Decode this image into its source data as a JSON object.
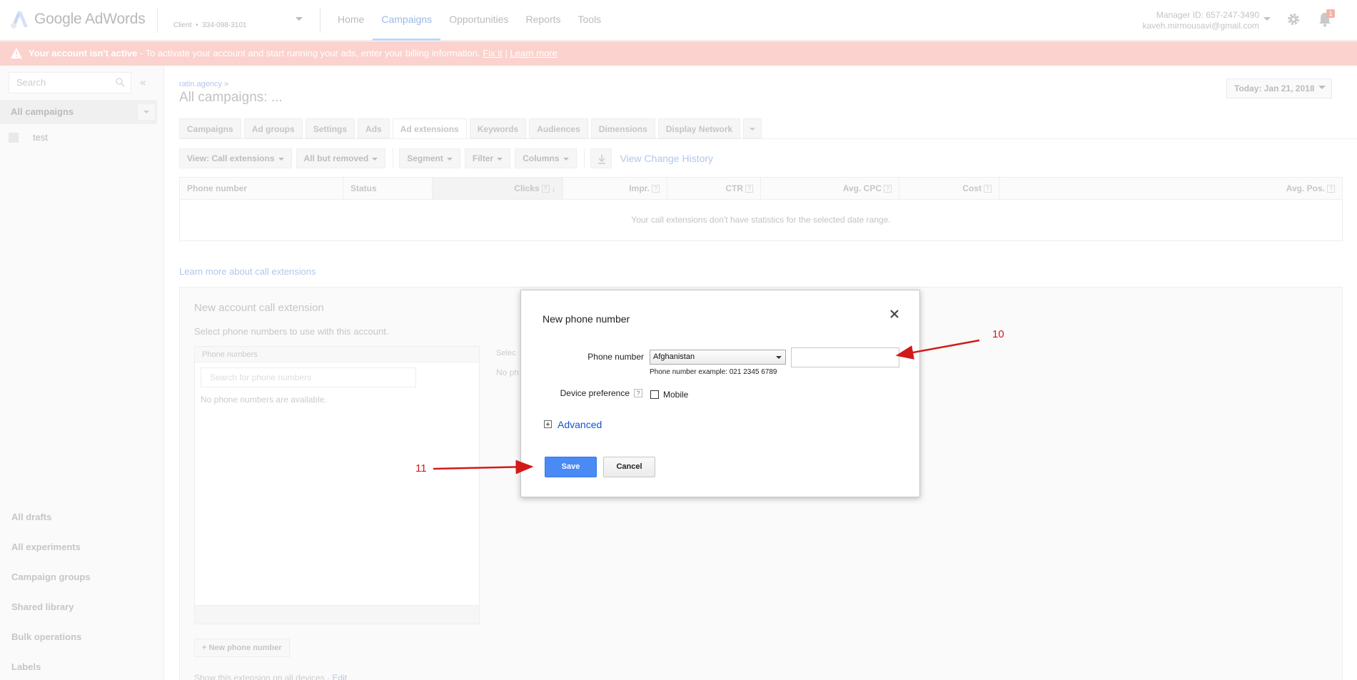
{
  "app": {
    "name": "Google AdWords"
  },
  "client": {
    "label": "Client",
    "id": "334-098-3101"
  },
  "nav": {
    "items": [
      "Home",
      "Campaigns",
      "Opportunities",
      "Reports",
      "Tools"
    ],
    "active": "Campaigns"
  },
  "account": {
    "manager_id": "Manager ID: 657-247-3490",
    "email": "kaveh.mirmousavi@gmail.com",
    "notifications": "1"
  },
  "alert": {
    "strong": "Your account isn't active",
    "text": " - To activate your account and start running your ads, enter your billing information. ",
    "fix": "Fix it",
    "sep": " | ",
    "learn": "Learn more"
  },
  "sidebar": {
    "search_placeholder": "Search",
    "collapse": "«",
    "all_campaigns": "All campaigns",
    "campaigns": [
      "test"
    ],
    "bottom_links": [
      "All drafts",
      "All experiments",
      "Campaign groups",
      "Shared library",
      "Bulk operations",
      "Labels"
    ]
  },
  "main": {
    "breadcrumb": "ratin.agency »",
    "title": "All campaigns: ...",
    "date": "Today: Jan 21, 2018",
    "tabs": [
      "Campaigns",
      "Ad groups",
      "Settings",
      "Ads",
      "Ad extensions",
      "Keywords",
      "Audiences",
      "Dimensions",
      "Display Network"
    ],
    "active_tab": "Ad extensions",
    "toolbar": {
      "view": "View: Call extensions",
      "filter_status": "All but removed",
      "segment": "Segment",
      "filter": "Filter",
      "columns": "Columns",
      "history": "View Change History"
    },
    "table": {
      "columns": [
        "Phone number",
        "Status",
        "Clicks",
        "Impr.",
        "CTR",
        "Avg. CPC",
        "Cost",
        "Avg. Pos."
      ],
      "help": "?",
      "empty": "Your call extensions don't have statistics for the selected date range."
    },
    "learn_call": "Learn more about call extensions",
    "new_call": {
      "title": "New account call extension",
      "subtitle": "Select phone numbers to use with this account.",
      "panel_header": "Phone numbers",
      "search_placeholder": "Search for phone numbers",
      "empty": "No phone numbers are available.",
      "right_header": "Selec",
      "right_body": "No ph",
      "new_number": "+ New phone number",
      "show_text": "Show this extension on all devices",
      "edit": "Edit"
    }
  },
  "modal": {
    "title": "New phone number",
    "phone_label": "Phone number",
    "country": "Afghanistan",
    "phone_value": "",
    "hint": "Phone number example: 021 2345 6789",
    "device_label": "Device preference",
    "help": "?",
    "mobile_label": "Mobile",
    "advanced": "Advanced",
    "save": "Save",
    "cancel": "Cancel"
  },
  "annotations": [
    {
      "label": "10"
    },
    {
      "label": "11"
    }
  ],
  "colors": {
    "accent": "#4a8af4",
    "alert_bg": "#fbd2cd",
    "annotation": "#d21a1a",
    "link": "#1155cc"
  }
}
